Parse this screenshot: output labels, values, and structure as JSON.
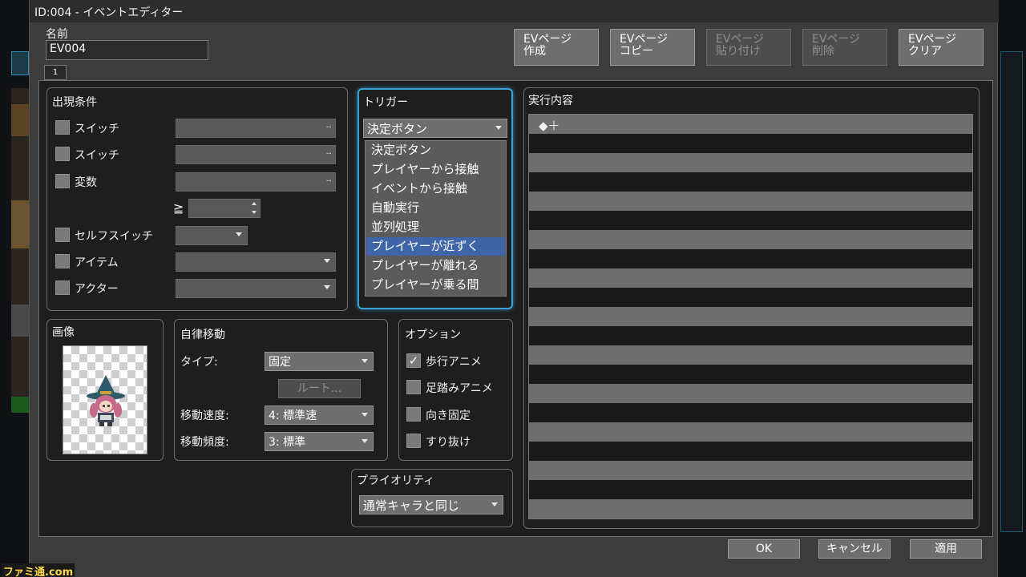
{
  "window": {
    "title": "ID:004 - イベントエディター"
  },
  "name_section": {
    "label": "名前",
    "value": "EV004"
  },
  "page_tab": "1",
  "top_buttons": [
    {
      "label": "EVページ\n作成",
      "enabled": true
    },
    {
      "label": "EVページ\nコピー",
      "enabled": true
    },
    {
      "label": "EVページ\n貼り付け",
      "enabled": false
    },
    {
      "label": "EVページ\n削除",
      "enabled": false
    },
    {
      "label": "EVページ\nクリア",
      "enabled": true
    }
  ],
  "conditions": {
    "title": "出現条件",
    "switch1": "スイッチ",
    "switch2": "スイッチ",
    "variable": "変数",
    "compare": "≧",
    "self_switch": "セルフスイッチ",
    "item": "アイテム",
    "actor": "アクター",
    "dots": "..."
  },
  "trigger": {
    "title": "トリガー",
    "selected": "決定ボタン",
    "options": [
      "決定ボタン",
      "プレイヤーから接触",
      "イベントから接触",
      "自動実行",
      "並列処理",
      "プレイヤーが近ずく",
      "プレイヤーが離れる",
      "プレイヤーが乗る間"
    ],
    "highlighted_index": 5
  },
  "contents": {
    "title": "実行内容",
    "first_line": "◆＋"
  },
  "image": {
    "title": "画像"
  },
  "movement": {
    "title": "自律移動",
    "type_label": "タイプ:",
    "type_value": "固定",
    "route_button": "ルート...",
    "speed_label": "移動速度:",
    "speed_value": "4: 標準速",
    "freq_label": "移動頻度:",
    "freq_value": "3: 標準"
  },
  "options": {
    "title": "オプション",
    "walk_anime": "歩行アニメ",
    "step_anime": "足踏みアニメ",
    "direction_fix": "向き固定",
    "through": "すり抜け",
    "walk_anime_checked": true,
    "check_mark": "✓"
  },
  "priority": {
    "title": "プライオリティ",
    "value": "通常キャラと同じ"
  },
  "footer": {
    "ok": "OK",
    "cancel": "キャンセル",
    "apply": "適用"
  },
  "watermark": "ファミ通.com",
  "colors": {
    "highlight": "#3f64a8",
    "focus_border": "#3aa3d6"
  }
}
